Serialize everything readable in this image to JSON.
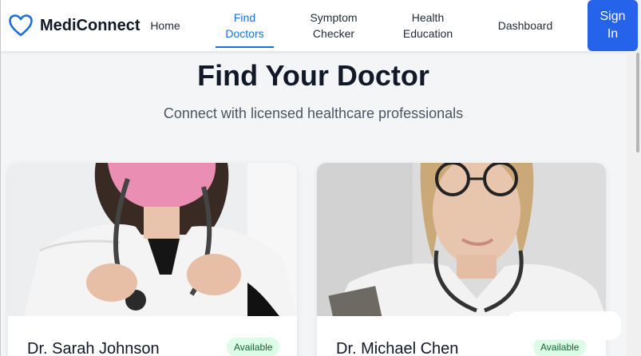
{
  "header": {
    "brand": "MediConnect",
    "logo_icon": "heart-icon",
    "nav": [
      {
        "label_line1": "Home",
        "label_line2": ""
      },
      {
        "label_line1": "Find",
        "label_line2": "Doctors"
      },
      {
        "label_line1": "Symptom",
        "label_line2": "Checker"
      },
      {
        "label_line1": "Health",
        "label_line2": "Education"
      },
      {
        "label_line1": "Dashboard",
        "label_line2": ""
      }
    ],
    "active_nav": "Find Doctors",
    "signin_line1": "Sign",
    "signin_line2": "In"
  },
  "hero": {
    "title": "Find Your Doctor",
    "subtitle": "Connect with licensed healthcare professionals"
  },
  "doctors": [
    {
      "name": "Dr. Sarah Johnson",
      "status": "Available"
    },
    {
      "name": "Dr. Michael Chen",
      "status": "Available"
    }
  ],
  "colors": {
    "accent": "#2563eb",
    "active_nav": "#1d6fd6",
    "badge_bg": "#dcfce7",
    "badge_text": "#166534"
  }
}
